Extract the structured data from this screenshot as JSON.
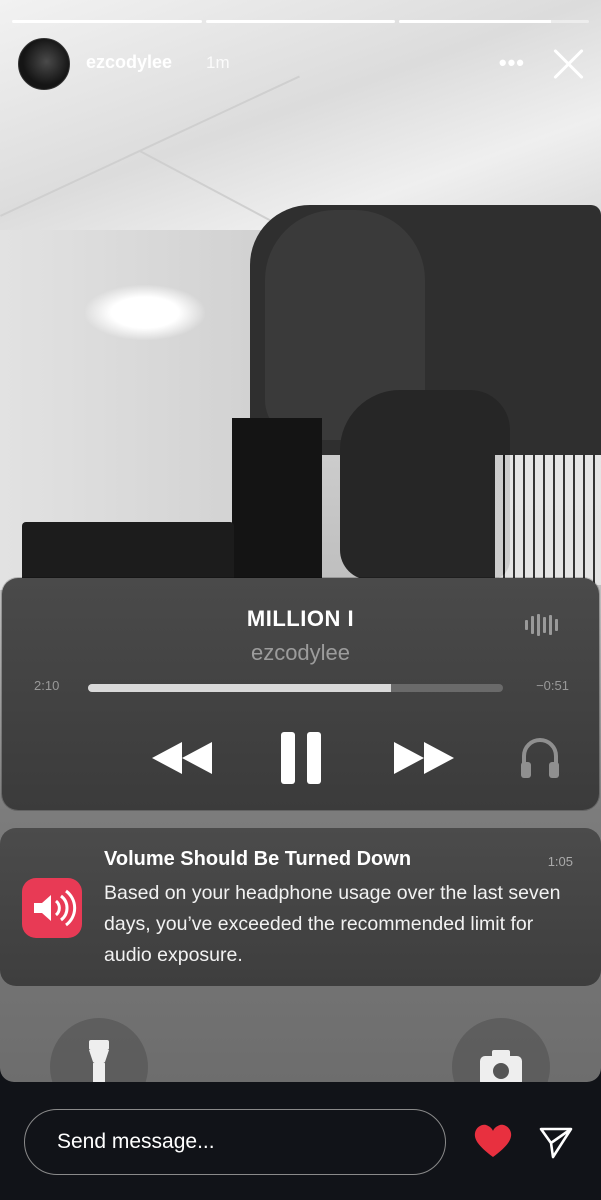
{
  "story": {
    "segments": [
      1,
      1,
      0.8
    ],
    "username": "ezcodylee",
    "time_ago": "1m",
    "more_label": "•••",
    "close_icon": "close-icon"
  },
  "player": {
    "title": "MILLION I",
    "artist": "ezcodylee",
    "elapsed": "2:10",
    "remaining": "−0:51",
    "progress": 0.73,
    "icons": [
      "airplay-icon",
      "rewind-icon",
      "pause-icon",
      "fast-forward-icon",
      "headphones-icon"
    ]
  },
  "notification": {
    "title": "Volume Should Be Turned Down",
    "time": "1:05",
    "body": "Based on your headphone usage over the last seven days, you’ve exceeded the recommended limit for audio exposure.",
    "icon_color": "#e83a55"
  },
  "footer": {
    "placeholder": "Send message...",
    "heart_color": "#e8303f"
  }
}
